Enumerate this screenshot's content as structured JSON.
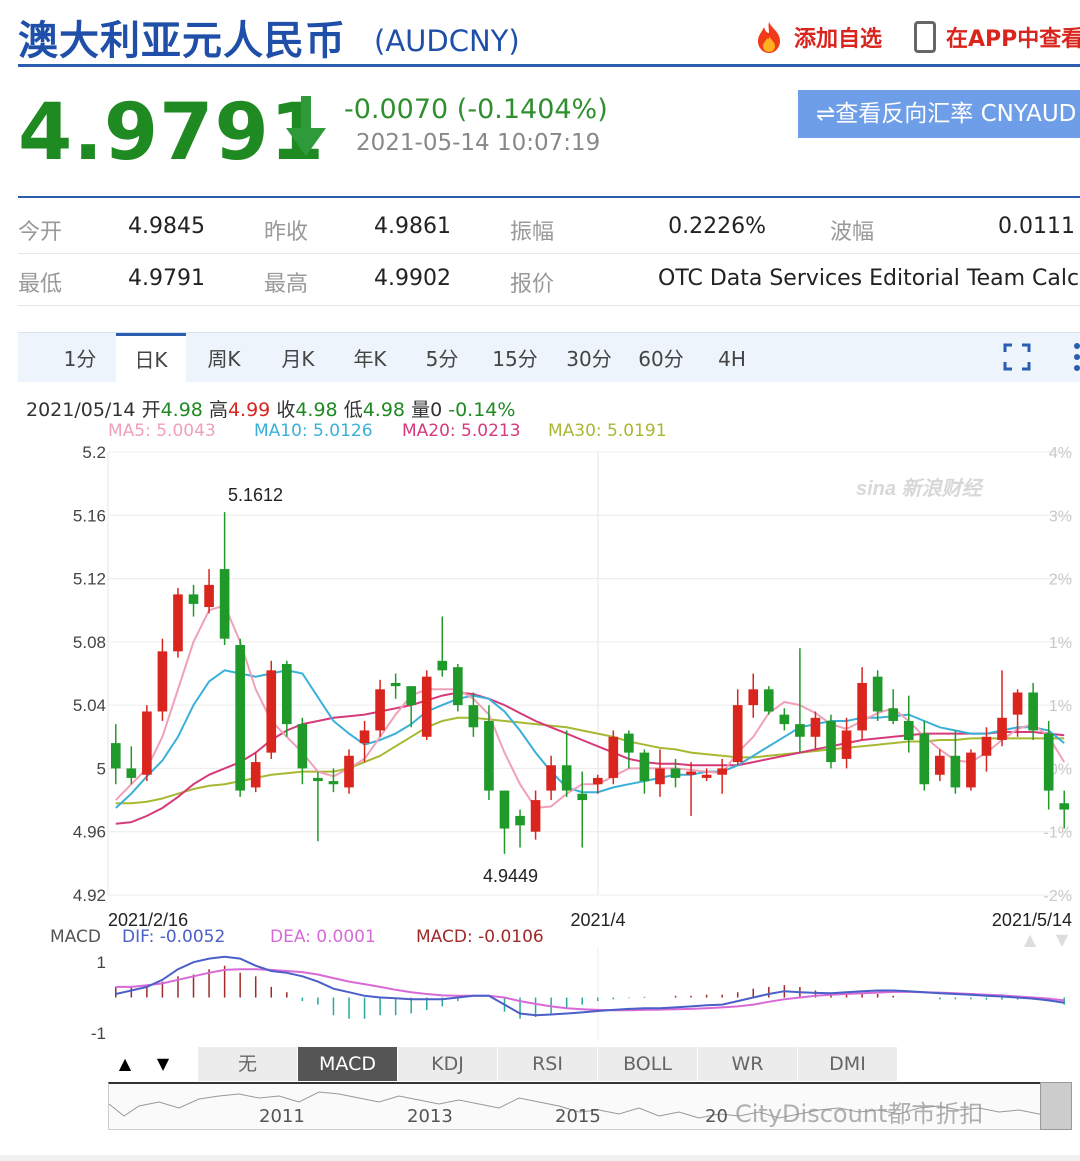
{
  "header": {
    "title": "澳大利亚元人民币",
    "code": "(AUDCNY)",
    "add_watch": "添加自选",
    "open_app": "在APP中查看"
  },
  "quote": {
    "price": "4.9791",
    "change": "-0.0070 (-0.1404%)",
    "timestamp": "2021-05-14 10:07:19",
    "reverse_button": "⇌查看反向汇率 CNYAUD",
    "price_color": "#1f8a22"
  },
  "stats": {
    "open_label": "今开",
    "open": "4.9845",
    "prev_close_label": "昨收",
    "prev_close": "4.9861",
    "amplitude_label": "振幅",
    "amplitude": "0.2226%",
    "range_label": "波幅",
    "range": "0.0111",
    "low_label": "最低",
    "low": "4.9791",
    "high_label": "最高",
    "high": "4.9902",
    "quote_label": "报价",
    "quote": "OTC Data Services Editorial Team Calc..."
  },
  "tabs": [
    "1分",
    "日K",
    "周K",
    "月K",
    "年K",
    "5分",
    "15分",
    "30分",
    "60分",
    "4H"
  ],
  "active_tab": "日K",
  "ohlc": {
    "date": "2021/05/14",
    "open_label": "开",
    "open": "4.98",
    "high_label": "高",
    "high": "4.99",
    "close_label": "收",
    "close": "4.98",
    "low_label": "低",
    "low": "4.98",
    "vol_label": "量",
    "vol": "0",
    "pct": "-0.14%"
  },
  "ma": {
    "ma5": "MA5: 5.0043",
    "ma10": "MA10: 5.0126",
    "ma20": "MA20: 5.0213",
    "ma30": "MA30: 5.0191"
  },
  "macd_legend": {
    "name": "MACD",
    "dif": "DIF: -0.0052",
    "dea": "DEA: 0.0001",
    "macd": "MACD: -0.0106"
  },
  "indicators": [
    "无",
    "MACD",
    "KDJ",
    "RSI",
    "BOLL",
    "WR",
    "DMI"
  ],
  "active_indicator": "MACD",
  "nav": {
    "up": "▲",
    "down": "▼"
  },
  "strip_years": [
    "2011",
    "2013",
    "2015",
    "20"
  ],
  "watermark": "CityDiscount都市折扣",
  "colors": {
    "up": "#d9251d",
    "down": "#1f9a2a",
    "ma5": "#f0a0b8",
    "ma10": "#3ab0d8",
    "ma20": "#d63a7a",
    "ma30": "#a8b832",
    "dif": "#4a5fc8",
    "dea": "#d86ad8",
    "macd_label": "#a02a2a"
  },
  "chart_data": {
    "type": "candlestick",
    "title": "",
    "y_ticks": [
      "5.2",
      "5.16",
      "5.12",
      "5.08",
      "5.04",
      "5",
      "4.96",
      "4.92"
    ],
    "pct_ticks": [
      "4%",
      "3%",
      "2%",
      "1%",
      "1%",
      "0%",
      "-1%",
      "-2%"
    ],
    "x_ticks": [
      "2021/2/16",
      "2021/4",
      "2021/5/14"
    ],
    "ylim": [
      4.92,
      5.2
    ],
    "annotations": [
      {
        "text": "5.1612",
        "kind": "high"
      },
      {
        "text": "4.9449",
        "kind": "low"
      }
    ],
    "candles": [
      [
        5.016,
        5.028,
        4.99,
        5.0
      ],
      [
        5.0,
        5.014,
        4.99,
        4.994
      ],
      [
        4.996,
        5.04,
        4.992,
        5.036
      ],
      [
        5.036,
        5.082,
        5.03,
        5.074
      ],
      [
        5.074,
        5.114,
        5.07,
        5.11
      ],
      [
        5.11,
        5.116,
        5.096,
        5.104
      ],
      [
        5.102,
        5.126,
        5.098,
        5.116
      ],
      [
        5.126,
        5.162,
        5.078,
        5.082
      ],
      [
        5.078,
        5.082,
        4.982,
        4.986
      ],
      [
        4.988,
        5.01,
        4.985,
        5.004
      ],
      [
        5.01,
        5.068,
        5.006,
        5.062
      ],
      [
        5.066,
        5.068,
        5.02,
        5.028
      ],
      [
        5.028,
        5.032,
        4.99,
        5.0
      ],
      [
        4.994,
        4.998,
        4.954,
        4.992
      ],
      [
        4.992,
        5.0,
        4.985,
        4.99
      ],
      [
        4.988,
        5.012,
        4.984,
        5.008
      ],
      [
        5.016,
        5.03,
        5.004,
        5.024
      ],
      [
        5.024,
        5.056,
        5.02,
        5.05
      ],
      [
        5.054,
        5.06,
        5.044,
        5.052
      ],
      [
        5.052,
        5.052,
        5.026,
        5.04
      ],
      [
        5.02,
        5.062,
        5.018,
        5.058
      ],
      [
        5.068,
        5.096,
        5.058,
        5.062
      ],
      [
        5.064,
        5.066,
        5.036,
        5.04
      ],
      [
        5.04,
        5.048,
        5.02,
        5.026
      ],
      [
        5.03,
        5.04,
        4.98,
        4.986
      ],
      [
        4.986,
        4.986,
        4.946,
        4.962
      ],
      [
        4.97,
        4.974,
        4.95,
        4.964
      ],
      [
        4.96,
        4.986,
        4.955,
        4.98
      ],
      [
        4.986,
        5.008,
        4.98,
        5.002
      ],
      [
        5.002,
        5.024,
        4.982,
        4.986
      ],
      [
        4.984,
        4.998,
        4.95,
        4.98
      ],
      [
        4.99,
        4.996,
        4.984,
        4.994
      ],
      [
        4.994,
        5.024,
        4.99,
        5.02
      ],
      [
        5.022,
        5.024,
        5.0,
        5.01
      ],
      [
        5.01,
        5.012,
        4.984,
        4.992
      ],
      [
        4.99,
        5.012,
        4.982,
        5.0
      ],
      [
        5.0,
        5.006,
        4.988,
        4.994
      ],
      [
        4.996,
        5.004,
        4.97,
        4.998
      ],
      [
        4.994,
        5.0,
        4.992,
        4.996
      ],
      [
        4.996,
        5.006,
        4.984,
        5.0
      ],
      [
        5.004,
        5.05,
        5.002,
        5.04
      ],
      [
        5.04,
        5.06,
        5.032,
        5.05
      ],
      [
        5.05,
        5.052,
        5.034,
        5.036
      ],
      [
        5.034,
        5.038,
        5.024,
        5.028
      ],
      [
        5.028,
        5.076,
        5.01,
        5.02
      ],
      [
        5.02,
        5.036,
        5.012,
        5.032
      ],
      [
        5.03,
        5.034,
        5.0,
        5.004
      ],
      [
        5.006,
        5.032,
        5.0,
        5.024
      ],
      [
        5.024,
        5.064,
        5.018,
        5.054
      ],
      [
        5.058,
        5.062,
        5.03,
        5.036
      ],
      [
        5.038,
        5.05,
        5.028,
        5.03
      ],
      [
        5.03,
        5.046,
        5.01,
        5.018
      ],
      [
        5.022,
        5.03,
        4.986,
        4.99
      ],
      [
        4.996,
        5.012,
        4.992,
        5.008
      ],
      [
        5.008,
        5.024,
        4.984,
        4.988
      ],
      [
        4.988,
        5.012,
        4.986,
        5.01
      ],
      [
        5.008,
        5.026,
        4.998,
        5.02
      ],
      [
        5.018,
        5.062,
        5.014,
        5.032
      ],
      [
        5.034,
        5.05,
        5.02,
        5.048
      ],
      [
        5.048,
        5.054,
        5.018,
        5.024
      ],
      [
        5.022,
        5.03,
        4.974,
        4.986
      ],
      [
        4.978,
        4.986,
        4.962,
        4.974
      ]
    ],
    "ma5": [
      4.98,
      4.99,
      5.0,
      5.02,
      5.05,
      5.08,
      5.1,
      5.103,
      5.08,
      5.05,
      5.03,
      5.02,
      5.01,
      4.998,
      4.995,
      5.0,
      5.006,
      5.02,
      5.034,
      5.046,
      5.05,
      5.05,
      5.05,
      5.044,
      5.034,
      5.01,
      4.99,
      4.975,
      4.976,
      4.984,
      4.99,
      4.99,
      4.995,
      5.0,
      5.0,
      5.0,
      5.0,
      4.999,
      4.998,
      4.997,
      5.01,
      5.02,
      5.035,
      5.042,
      5.04,
      5.035,
      5.028,
      5.025,
      5.03,
      5.035,
      5.038,
      5.03,
      5.02,
      5.012,
      5.005,
      5.004,
      5.01,
      5.018,
      5.025,
      5.028,
      5.02,
      5.004
    ],
    "ma10": [
      4.975,
      4.984,
      4.995,
      5.005,
      5.02,
      5.04,
      5.055,
      5.062,
      5.06,
      5.058,
      5.06,
      5.062,
      5.06,
      5.045,
      5.03,
      5.022,
      5.015,
      5.018,
      5.022,
      5.028,
      5.036,
      5.04,
      5.044,
      5.046,
      5.044,
      5.036,
      5.024,
      5.01,
      4.998,
      4.988,
      4.985,
      4.985,
      4.988,
      4.99,
      4.992,
      4.994,
      4.996,
      4.996,
      4.998,
      4.998,
      5.002,
      5.008,
      5.014,
      5.02,
      5.026,
      5.028,
      5.03,
      5.03,
      5.032,
      5.032,
      5.033,
      5.034,
      5.03,
      5.026,
      5.024,
      5.022,
      5.022,
      5.024,
      5.026,
      5.026,
      5.024,
      5.016
    ],
    "ma20": [
      4.965,
      4.966,
      4.97,
      4.975,
      4.982,
      4.99,
      4.996,
      5.0,
      5.004,
      5.01,
      5.018,
      5.024,
      5.028,
      5.03,
      5.032,
      5.033,
      5.034,
      5.036,
      5.038,
      5.04,
      5.043,
      5.046,
      5.048,
      5.047,
      5.044,
      5.04,
      5.035,
      5.03,
      5.026,
      5.022,
      5.018,
      5.014,
      5.01,
      5.006,
      5.004,
      5.003,
      5.003,
      5.002,
      5.002,
      5.002,
      5.002,
      5.004,
      5.006,
      5.008,
      5.01,
      5.012,
      5.014,
      5.016,
      5.018,
      5.019,
      5.02,
      5.021,
      5.022,
      5.022,
      5.022,
      5.022,
      5.022,
      5.023,
      5.023,
      5.023,
      5.022,
      5.021
    ],
    "ma30": [
      4.978,
      4.978,
      4.979,
      4.981,
      4.984,
      4.987,
      4.989,
      4.99,
      4.992,
      4.994,
      4.996,
      4.997,
      4.998,
      4.998,
      4.998,
      5.0,
      5.004,
      5.008,
      5.014,
      5.02,
      5.026,
      5.03,
      5.032,
      5.032,
      5.031,
      5.03,
      5.029,
      5.028,
      5.027,
      5.026,
      5.024,
      5.022,
      5.02,
      5.017,
      5.015,
      5.013,
      5.012,
      5.01,
      5.009,
      5.008,
      5.007,
      5.007,
      5.008,
      5.009,
      5.01,
      5.011,
      5.012,
      5.013,
      5.014,
      5.015,
      5.016,
      5.017,
      5.017,
      5.018,
      5.018,
      5.019,
      5.019,
      5.019,
      5.019,
      5.019,
      5.019,
      5.019
    ],
    "macd_ticks": [
      "1",
      "-1"
    ],
    "macd_ylim": [
      -1.2,
      1.4
    ],
    "dif": [
      0.1,
      0.2,
      0.3,
      0.5,
      0.8,
      1.0,
      1.1,
      1.15,
      1.1,
      0.9,
      0.75,
      0.7,
      0.6,
      0.45,
      0.25,
      0.15,
      0.05,
      0.0,
      -0.02,
      -0.05,
      -0.05,
      -0.05,
      0.0,
      0.05,
      0.05,
      -0.2,
      -0.45,
      -0.5,
      -0.48,
      -0.45,
      -0.42,
      -0.38,
      -0.35,
      -0.32,
      -0.3,
      -0.3,
      -0.28,
      -0.25,
      -0.22,
      -0.2,
      -0.1,
      0.0,
      0.1,
      0.18,
      0.15,
      0.13,
      0.12,
      0.15,
      0.18,
      0.2,
      0.2,
      0.18,
      0.15,
      0.12,
      0.1,
      0.08,
      0.05,
      0.03,
      0.0,
      -0.03,
      -0.08,
      -0.15
    ],
    "dea": [
      0.3,
      0.3,
      0.35,
      0.4,
      0.5,
      0.6,
      0.7,
      0.78,
      0.8,
      0.8,
      0.78,
      0.75,
      0.72,
      0.65,
      0.55,
      0.45,
      0.38,
      0.3,
      0.22,
      0.15,
      0.1,
      0.06,
      0.05,
      0.05,
      0.05,
      0.0,
      -0.1,
      -0.18,
      -0.25,
      -0.3,
      -0.33,
      -0.35,
      -0.36,
      -0.36,
      -0.35,
      -0.34,
      -0.33,
      -0.32,
      -0.3,
      -0.28,
      -0.25,
      -0.2,
      -0.12,
      -0.05,
      0.0,
      0.05,
      0.08,
      0.1,
      0.12,
      0.14,
      0.16,
      0.16,
      0.15,
      0.14,
      0.12,
      0.1,
      0.08,
      0.06,
      0.03,
      0.0,
      -0.03,
      -0.08
    ],
    "macd_hist": [
      0.3,
      0.3,
      0.35,
      0.45,
      0.6,
      0.65,
      0.8,
      0.9,
      0.7,
      0.6,
      0.3,
      0.15,
      -0.1,
      -0.2,
      -0.5,
      -0.6,
      -0.6,
      -0.5,
      -0.5,
      -0.45,
      -0.35,
      -0.25,
      -0.1,
      0.0,
      0.0,
      -0.4,
      -0.6,
      -0.55,
      -0.45,
      -0.3,
      -0.2,
      -0.1,
      -0.05,
      -0.02,
      0.02,
      0.0,
      0.05,
      0.05,
      0.08,
      0.08,
      0.15,
      0.25,
      0.3,
      0.35,
      0.3,
      0.2,
      0.1,
      0.1,
      0.1,
      0.1,
      0.05,
      0.0,
      0.0,
      -0.05,
      -0.05,
      -0.05,
      -0.06,
      -0.06,
      -0.06,
      -0.06,
      -0.1,
      -0.2
    ]
  }
}
